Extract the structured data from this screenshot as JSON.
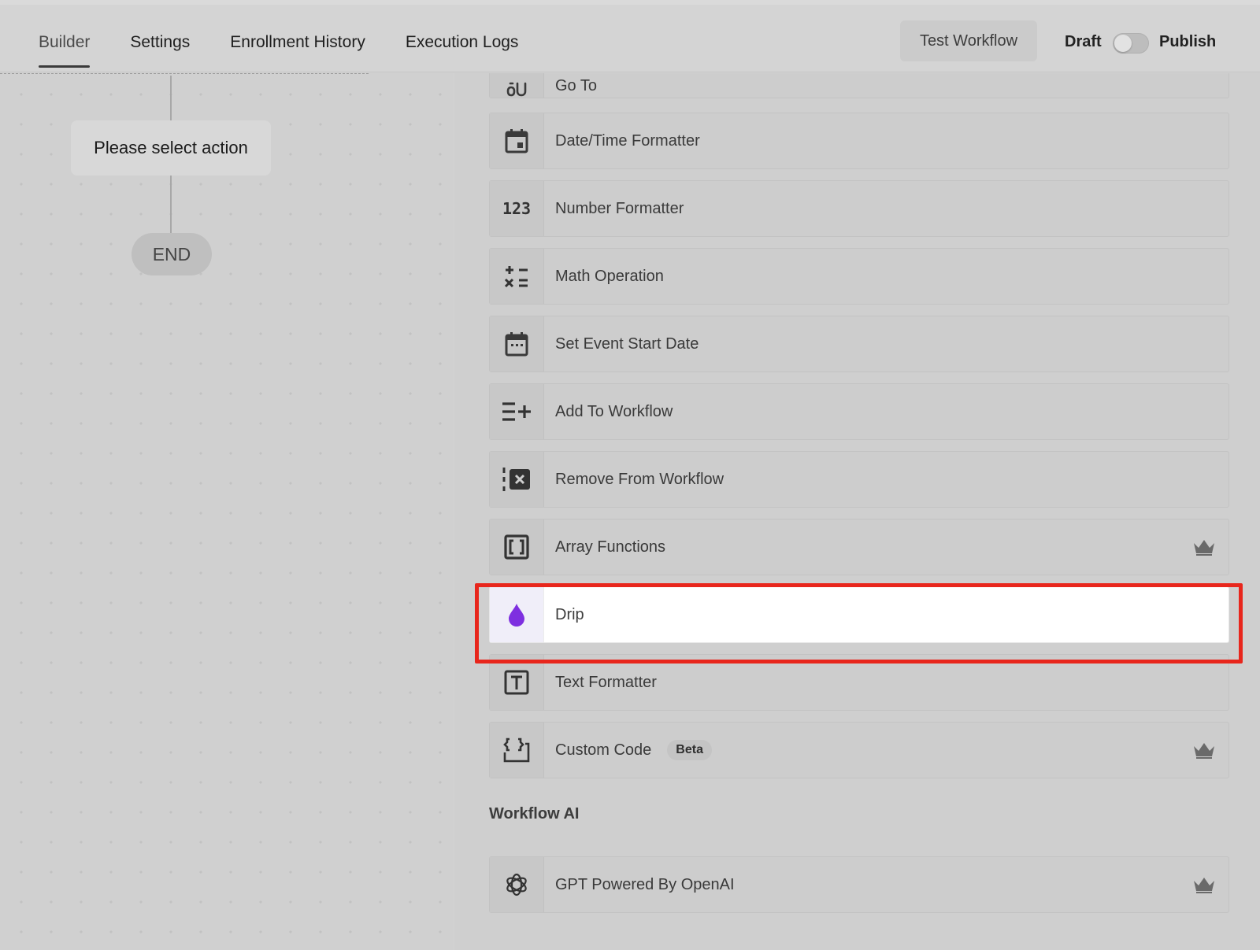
{
  "tabs": [
    {
      "label": "Builder",
      "active": true
    },
    {
      "label": "Settings",
      "active": false
    },
    {
      "label": "Enrollment History",
      "active": false
    },
    {
      "label": "Execution Logs",
      "active": false
    }
  ],
  "header": {
    "test_workflow": "Test Workflow",
    "draft": "Draft",
    "publish": "Publish",
    "publish_toggle_on": false
  },
  "canvas": {
    "action_placeholder": "Please select action",
    "end_label": "END"
  },
  "actions": [
    {
      "label": "Go To",
      "icon": "go-to-icon",
      "premium": false
    },
    {
      "label": "Date/Time Formatter",
      "icon": "calendar-icon",
      "premium": false
    },
    {
      "label": "Number Formatter",
      "icon": "number-123-icon",
      "premium": false
    },
    {
      "label": "Math Operation",
      "icon": "math-operators-icon",
      "premium": false
    },
    {
      "label": "Set Event Start Date",
      "icon": "calendar-dots-icon",
      "premium": false
    },
    {
      "label": "Add To Workflow",
      "icon": "list-add-icon",
      "premium": false
    },
    {
      "label": "Remove From Workflow",
      "icon": "remove-x-icon",
      "premium": false
    },
    {
      "label": "Array Functions",
      "icon": "brackets-icon",
      "premium": true
    },
    {
      "label": "Drip",
      "icon": "drop-icon",
      "premium": false,
      "highlighted": true
    },
    {
      "label": "Text Formatter",
      "icon": "text-t-icon",
      "premium": false
    },
    {
      "label": "Custom Code",
      "icon": "code-braces-icon",
      "premium": true,
      "badge": "Beta"
    }
  ],
  "section_ai": {
    "title": "Workflow AI",
    "items": [
      {
        "label": "GPT Powered By OpenAI",
        "icon": "openai-icon",
        "premium": true
      }
    ]
  },
  "colors": {
    "highlight": "#e8261c",
    "drip_purple": "#7e2fe0"
  }
}
